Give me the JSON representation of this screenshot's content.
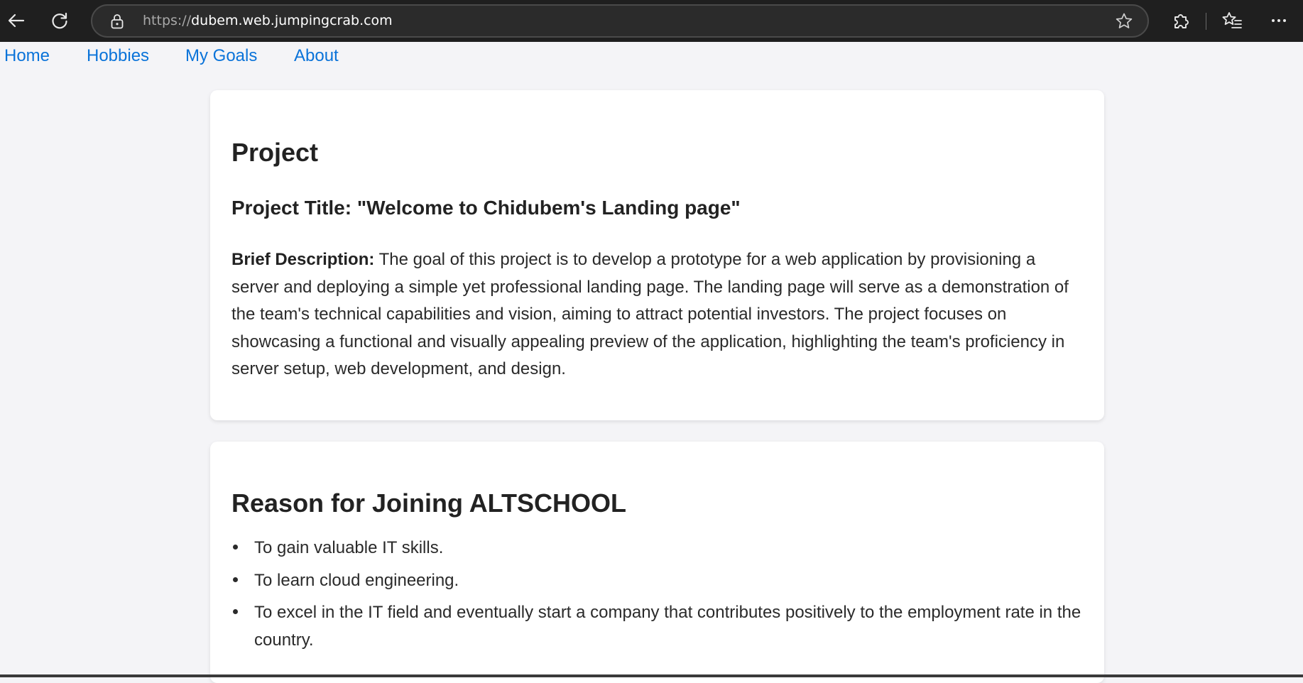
{
  "browser": {
    "url_scheme": "https://",
    "url_host": "dubem.web.jumpingcrab.com",
    "icons": {
      "back": "arrow-left-icon",
      "reload": "reload-icon",
      "lock": "lock-icon",
      "favorite": "star-outline-icon",
      "extensions": "puzzle-icon",
      "favorites": "favorites-list-icon",
      "more": "ellipsis-icon"
    }
  },
  "nav": {
    "links": [
      "Home",
      "Hobbies",
      "My Goals",
      "About"
    ],
    "link_color": "#0a73d9"
  },
  "project": {
    "heading": "Project",
    "title": "Project Title: \"Welcome to Chidubem's Landing page\"",
    "description_label": "Brief Description:",
    "description": " The goal of this project is to develop a prototype for a web application by provisioning a server and deploying a simple yet professional landing page. The landing page will serve as a demonstration of the team's technical capabilities and vision, aiming to attract potential investors. The project focuses on showcasing a functional and visually appealing preview of the application, highlighting the team's proficiency in server setup, web development, and design."
  },
  "reason": {
    "heading": "Reason for Joining ALTSCHOOL",
    "items": [
      "To gain valuable IT skills.",
      "To learn cloud engineering.",
      "To excel in the IT field and eventually start a company that contributes positively to the employment rate in the country."
    ]
  },
  "colors": {
    "page_background": "#f4f4f7",
    "card_background": "#ffffff",
    "toolbar_background": "#1f1f1f"
  }
}
